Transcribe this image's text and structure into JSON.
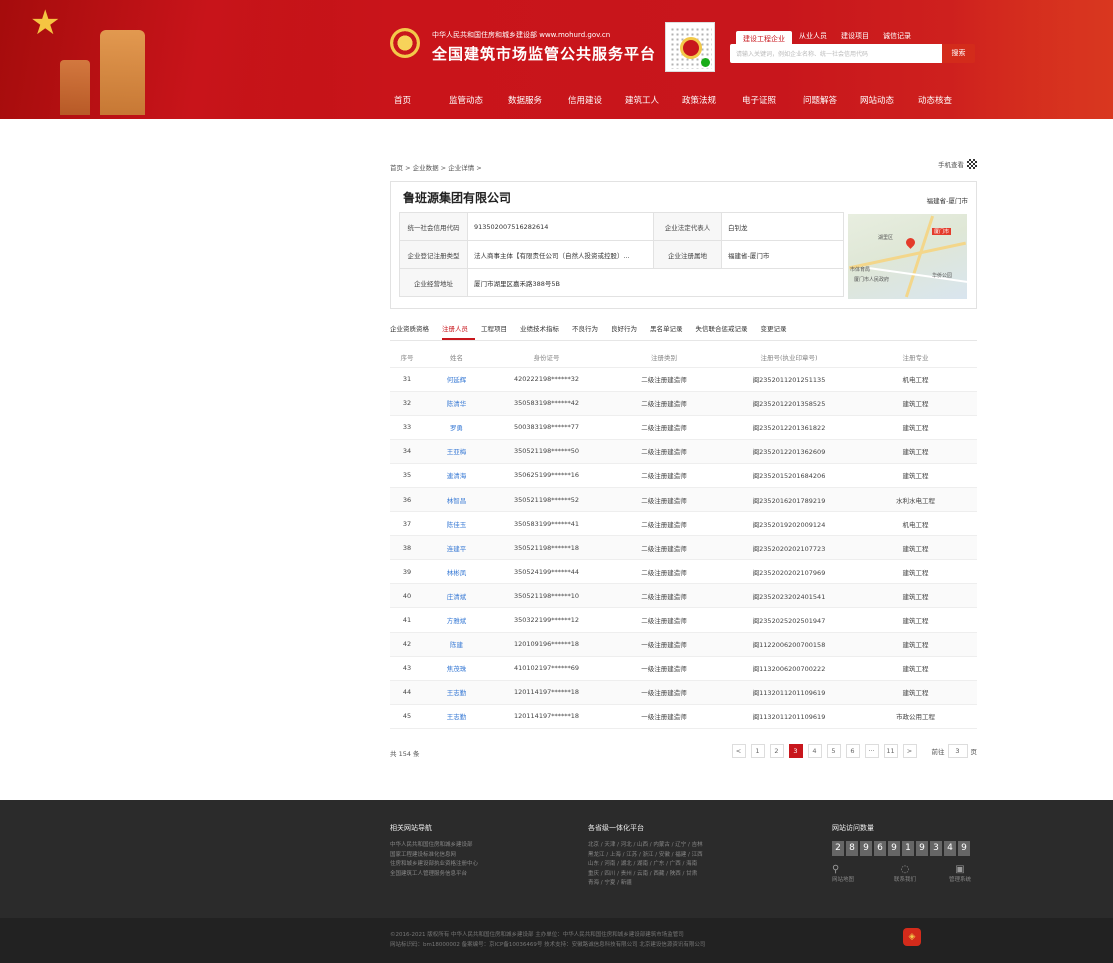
{
  "header": {
    "site_sub": "中华人民共和国住房和城乡建设部   www.mohurd.gov.cn",
    "site_title": "全国建筑市场监管公共服务平台",
    "search_tabs": [
      "建设工程企业",
      "从业人员",
      "建设项目",
      "诚信记录"
    ],
    "search_placeholder": "请输入关键词，例如企业名称、统一社会信用代码",
    "search_button": "搜索",
    "nav": [
      "首页",
      "监管动态",
      "数据服务",
      "信用建设",
      "建筑工人",
      "政策法规",
      "电子证照",
      "问题解答",
      "网站动态",
      "动态核查"
    ],
    "brand_color": "#c8161c"
  },
  "breadcrumb": [
    "首页",
    "企业数据",
    "企业详情"
  ],
  "mobile_view": "手机查看",
  "company": {
    "name": "鲁班源集团有限公司",
    "province": "福建省-厦门市",
    "credit_code_label": "统一社会信用代码",
    "credit_code": "91350200751628261​4",
    "legal_rep_label": "企业法定代表人",
    "legal_rep": "白钊龙",
    "reg_type_label": "企业登记注册类型",
    "reg_type": "法人商事主体【有限责任公司（自然人投资或控股）...",
    "reg_place_label": "企业注册属地",
    "reg_place": "福建省-厦门市",
    "address_label": "企业经营地址",
    "address": "厦门市湖里区嘉禾路388号5B"
  },
  "map_labels": [
    "厦门市",
    "湖里区",
    "市体育局",
    "厦门市人民政府",
    "华侨公园"
  ],
  "tabs": [
    "企业资质资格",
    "注册人员",
    "工程项目",
    "业绩技术指标",
    "不良行为",
    "良好行为",
    "黑名单记录",
    "失信联合惩戒记录",
    "变更记录"
  ],
  "active_tab": 1,
  "table": {
    "headers": [
      "序号",
      "姓名",
      "身份证号",
      "注册类别",
      "注册号(执业印章号)",
      "注册专业"
    ],
    "rows": [
      [
        "31",
        "何延辉",
        "420222198******32",
        "二级注册建造师",
        "闽2352011201251135",
        "机电工程"
      ],
      [
        "32",
        "陈清华",
        "350583198******42",
        "二级注册建造师",
        "闽2352012201358525",
        "建筑工程"
      ],
      [
        "33",
        "罗勇",
        "500383198******77",
        "二级注册建造师",
        "闽2352012201361822",
        "建筑工程"
      ],
      [
        "34",
        "王亚梅",
        "350521198******50",
        "二级注册建造师",
        "闽2352012201362609",
        "建筑工程"
      ],
      [
        "35",
        "連清海",
        "350625199******16",
        "二级注册建造师",
        "闽2352015201684206",
        "建筑工程"
      ],
      [
        "36",
        "林智昌",
        "350521198******52",
        "二级注册建造师",
        "闽2352016201789219",
        "水利水电工程"
      ],
      [
        "37",
        "陈佳玉",
        "350583199******41",
        "二级注册建造师",
        "闽2352019202009124",
        "机电工程"
      ],
      [
        "38",
        "连建平",
        "350521198******18",
        "二级注册建造师",
        "闽2352020202107723",
        "建筑工程"
      ],
      [
        "39",
        "林彬凤",
        "350524199******44",
        "二级注册建造师",
        "闽2352020202107969",
        "建筑工程"
      ],
      [
        "40",
        "庄清斌",
        "350521198******10",
        "二级注册建造师",
        "闽2352023202401541",
        "建筑工程"
      ],
      [
        "41",
        "方雅斌",
        "350322199******12",
        "二级注册建造师",
        "闽2352025202501947",
        "建筑工程"
      ],
      [
        "42",
        "陈建",
        "120109196******18",
        "一级注册建造师",
        "闽1122006200700158",
        "建筑工程"
      ],
      [
        "43",
        "焦茂珠",
        "410102197******69",
        "一级注册建造师",
        "闽1132006200700222",
        "建筑工程"
      ],
      [
        "44",
        "王志勤",
        "120114197******18",
        "一级注册建造师",
        "闽1132011201109619",
        "建筑工程"
      ],
      [
        "45",
        "王志勤",
        "120114197******18",
        "一级注册建造师",
        "闽1132011201109619",
        "市政公用工程"
      ]
    ]
  },
  "pagination": {
    "total": "共 154 条",
    "pages": [
      "<",
      "1",
      "2",
      "3",
      "4",
      "5",
      "6",
      "···",
      "11",
      ">"
    ],
    "active": "3",
    "goto_label": "前往",
    "goto_value": "3",
    "page_unit": "页"
  },
  "footer": {
    "nav_title": "相关网站导航",
    "nav_links": [
      "中华人民共和国住房和城乡建设部",
      "国家工程建设标准化信息网",
      "住房和城乡建设部执业资格注册中心",
      "全国建筑工人管理服务信息平台"
    ],
    "prov_title": "各省级一体化平台",
    "prov_lines": [
      "北京 / 天津 / 河北 / 山西 / 内蒙古 / 辽宁 / 吉林",
      "黑龙江 / 上海 / 江苏 / 浙江 / 安徽 / 福建 / 江西",
      "山东 / 河南 / 湖北 / 湖南 / 广东 / 广西 / 海南",
      "重庆 / 四川 / 贵州 / 云南 / 西藏 / 陕西 / 甘肃",
      "青海 / 宁夏 / 新疆"
    ],
    "visit_title": "网站访问数量",
    "visit_digits": [
      "2",
      "8",
      "9",
      "6",
      "9",
      "1",
      "9",
      "3",
      "4",
      "9"
    ],
    "icons": [
      "网站地图",
      "联系我们",
      "管理系统"
    ],
    "copyright": "©2016-2021 版权所有 中华人民共和国住房和城乡建设部   主办单位：中华人民共和国住房和城乡建设部建筑市场监管司",
    "icp": "网站标识码：bm18000002   备案编号：京ICP备10036469号   技术支持：安徽路诚信息科技有限公司 北京建设信源资讯有限公司"
  }
}
